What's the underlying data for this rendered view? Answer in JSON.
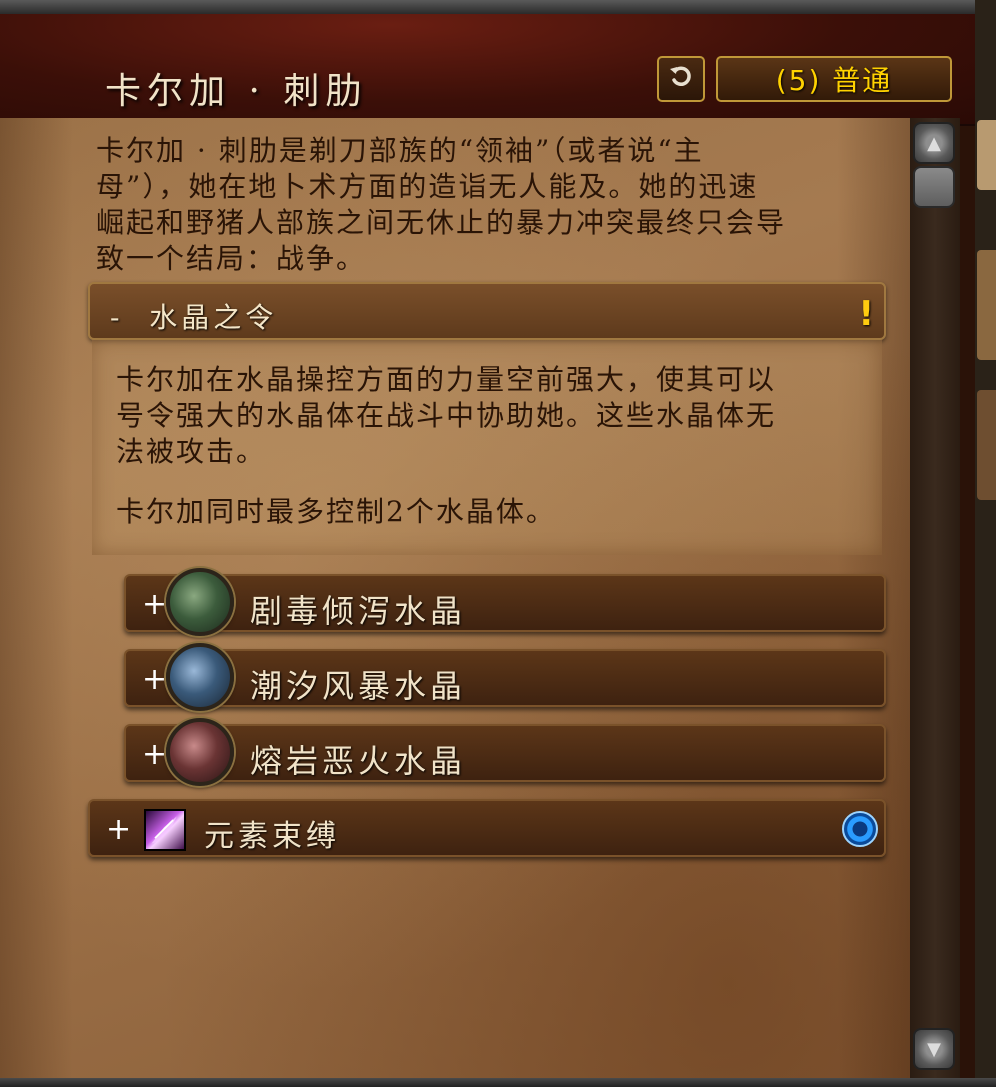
{
  "header": {
    "title": "卡尔加 · 刺肋",
    "reset_icon": "undo-arrow-icon",
    "difficulty_label": "(5) 普通"
  },
  "description": [
    "卡尔加 · 刺肋是剃刀部族的“领袖”（或者说“主",
    "母”），她在地卜术方面的造诣无人能及。她的迅速",
    "崛起和野猪人部族之间无休止的暴力冲突最终只会导",
    "致一个结局：战争。"
  ],
  "section": {
    "toggle": "-",
    "label": "水晶之令",
    "warning_icon": "exclamation-icon",
    "body": [
      "卡尔加在水晶操控方面的力量空前强大，使其可以",
      "号令强大的水晶体在战斗中协助她。这些水晶体无",
      "法被攻击。"
    ],
    "note": "卡尔加同时最多控制2个水晶体。"
  },
  "abilities": [
    {
      "toggle": "+",
      "label": "剧毒倾泻水晶",
      "icon": "green-crystal-orb-icon",
      "color": "#5a7a4a"
    },
    {
      "toggle": "+",
      "label": "潮汐风暴水晶",
      "icon": "blue-crystal-orb-icon",
      "color": "#4a6a8a"
    },
    {
      "toggle": "+",
      "label": "熔岩恶火水晶",
      "icon": "red-crystal-orb-icon",
      "color": "#8a4a4a"
    }
  ],
  "spell": {
    "toggle": "+",
    "label": "元素束缚",
    "icon": "elemental-bond-spell-icon",
    "flag_icon": "interrupt-icon"
  },
  "colors": {
    "title_text": "#f1e3c8",
    "difficulty_text": "#ffd200",
    "button_border": "#c09838",
    "body_text": "#2a1406",
    "warning": "#ffcc10",
    "interrupt": "#2a9cff"
  }
}
